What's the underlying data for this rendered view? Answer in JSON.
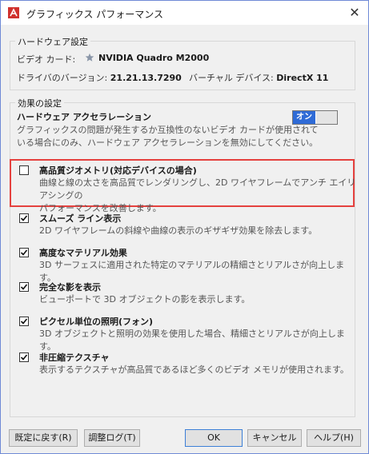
{
  "window": {
    "title": "グラフィックス パフォーマンス",
    "close_glyph": "✕"
  },
  "hardware": {
    "legend": "ハードウェア設定",
    "video_card_label": "ビデオ カード:",
    "video_card_value": "NVIDIA Quadro M2000",
    "driver_label": "ドライバのバージョン:",
    "driver_value": "21.21.13.7290",
    "virtual_device_label": "バーチャル デバイス:",
    "virtual_device_value": "DirectX 11"
  },
  "effects": {
    "legend": "効果の設定",
    "hw_accel": {
      "title": "ハードウェア アクセラレーション",
      "toggle_label": "オン",
      "desc_line1": "グラフィックスの問題が発生するか互換性のないビデオ カードが使用されて",
      "desc_line2": "いる場合にのみ、ハードウェア アクセラレーションを無効にしてください。"
    },
    "items": [
      {
        "title": "高品質ジオメトリ(対応デバイスの場合)",
        "checked": false,
        "desc_line1": "曲線と線の太さを高品質でレンダリングし、2D ワイヤフレームでアンチ エイリアシングの",
        "desc_line2": "パフォーマンスを改善します。"
      },
      {
        "title": "スムーズ ライン表示",
        "checked": true,
        "desc_line1": "2D ワイヤフレームの斜線や曲線の表示のギザギザ効果を除去します。"
      },
      {
        "title": "高度なマテリアル効果",
        "checked": true,
        "desc_line1": "3D サーフェスに適用された特定のマテリアルの精細さとリアルさが向上します。"
      },
      {
        "title": "完全な影を表示",
        "checked": true,
        "desc_line1": "ビューポートで 3D オブジェクトの影を表示します。"
      },
      {
        "title": "ピクセル単位の照明(フォン)",
        "checked": true,
        "desc_line1": "3D オブジェクトと照明の効果を使用した場合、精細さとリアルさが向上します。"
      },
      {
        "title": "非圧縮テクスチャ",
        "checked": true,
        "desc_line1": "表示するテクスチャが高品質であるほど多くのビデオ メモリが使用されます。"
      }
    ]
  },
  "buttons": {
    "reset": "既定に戻す(R)",
    "log": "調整ログ(T)",
    "ok": "OK",
    "cancel": "キャンセル",
    "help": "ヘルプ(H)"
  },
  "colors": {
    "accent": "#2f6bd6",
    "highlight": "#e5413e",
    "app_icon": "#d0312d"
  }
}
